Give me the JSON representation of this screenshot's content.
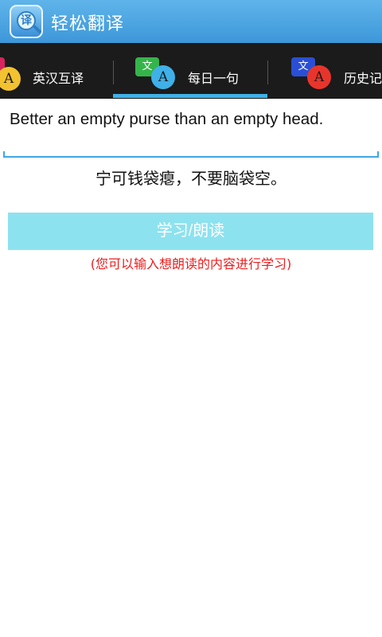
{
  "app_bar": {
    "title": "轻松翻译",
    "icon_glyph": "译"
  },
  "tabs": [
    {
      "label": "英汉互译",
      "icon": "translate-icon",
      "bubble_char": "",
      "front_char": "A",
      "back_color": "#d8245e",
      "front_color": "#f2c230",
      "selected": false
    },
    {
      "label": "每日一句",
      "icon": "translate-icon",
      "bubble_char": "文",
      "front_char": "A",
      "back_color": "#35b44a",
      "front_color": "#3fb0e8",
      "selected": true
    },
    {
      "label": "历史记录",
      "icon": "translate-icon",
      "bubble_char": "文",
      "front_char": "A",
      "back_color": "#2a4fd6",
      "front_color": "#e8352c",
      "selected": false
    }
  ],
  "input": {
    "value": "Better an empty purse than an empty head."
  },
  "translation": "宁可钱袋瘪，不要脑袋空。",
  "study_button": {
    "label": "学习/朗读"
  },
  "hint": "(您可以输入想朗读的内容进行学习)",
  "colors": {
    "app_bar": "#4aa6e2",
    "tab_bar": "#1b1b1b",
    "tab_indicator": "#3fb0e8",
    "button": "#8de2ef",
    "hint": "#ee1c1c"
  }
}
